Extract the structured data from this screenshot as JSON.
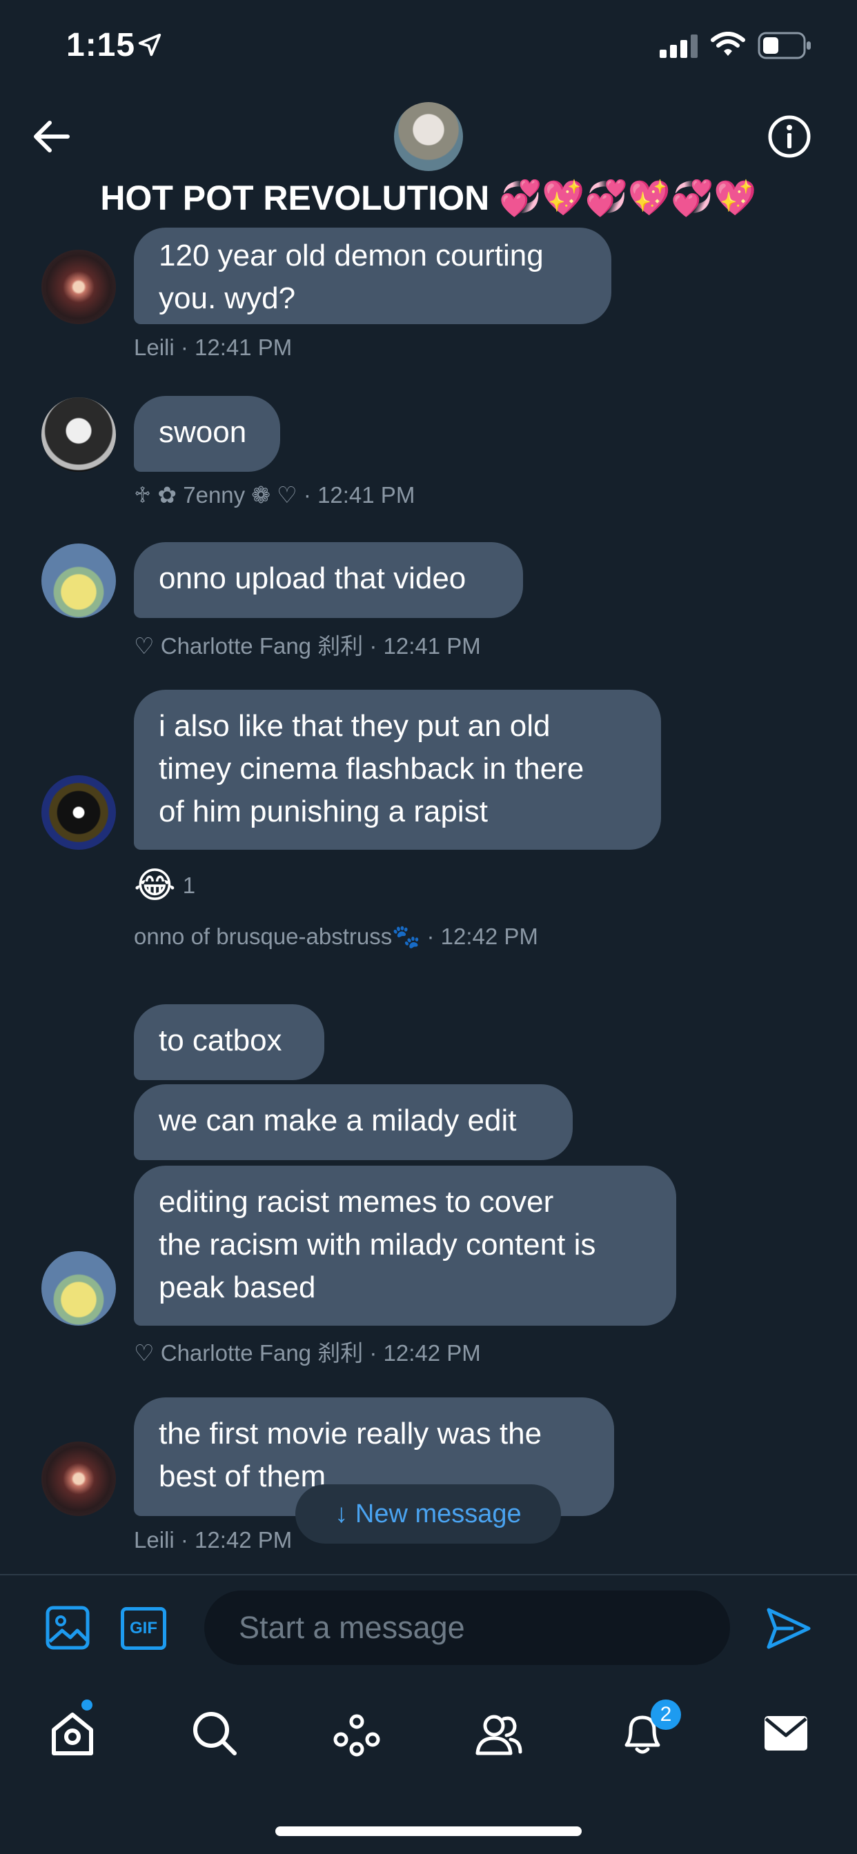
{
  "status_bar": {
    "time": "1:15"
  },
  "header": {
    "title": "HOT POT REVOLUTION 💞💖💞💖💞💖"
  },
  "messages": [
    {
      "author": "Leili",
      "text": "120 year old demon courting you. wyd?",
      "line1": "120 year old demon courting",
      "line2": "you. wyd?",
      "meta": "Leili · 12:41 PM"
    },
    {
      "author": "♱ ✿ 7enny ❁ ♡",
      "text": "swoon",
      "meta": "♱ ✿ 7enny ❁ ♡ · 12:41 PM"
    },
    {
      "author": "♡ Charlotte Fang 刹利",
      "text": "onno upload that video",
      "meta": "♡ Charlotte Fang 刹利 · 12:41 PM"
    },
    {
      "author": "onno of brusque-abstruss🐾",
      "line1": "i also like that they put an old",
      "line2": "timey cinema flashback in there",
      "line3": "of him punishing a rapist",
      "reaction": {
        "emoji": "😂",
        "count": "1"
      },
      "meta": "onno of brusque-abstruss🐾 · 12:42 PM"
    },
    {
      "author": "♡ Charlotte Fang 刹利",
      "text1": "to catbox",
      "text2": "we can make a milady edit",
      "line1": "editing racist memes to cover",
      "line2": "the racism with milady content is",
      "line3": "peak based",
      "meta": "♡ Charlotte Fang 刹利 · 12:42 PM"
    },
    {
      "author": "Leili",
      "line1": "the first movie really was the",
      "line2": "best of them",
      "meta": "Leili · 12:42 PM"
    }
  ],
  "new_message_button": {
    "label": "↓ New message"
  },
  "composer": {
    "placeholder": "Start a message",
    "gif_label": "GIF"
  },
  "nav": {
    "notifications_badge": "2"
  },
  "colors": {
    "background": "#15202b",
    "bubble": "#45566a",
    "accent": "#1d9bf0",
    "meta_text": "#8b98a5"
  }
}
